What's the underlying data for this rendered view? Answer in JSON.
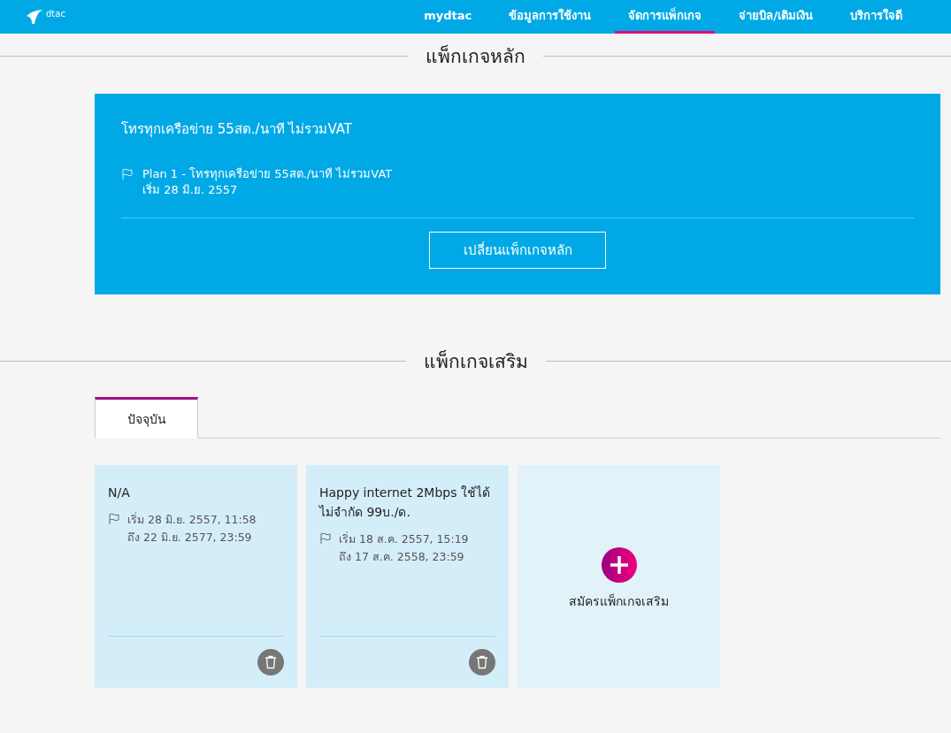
{
  "header": {
    "logo_text": "dtac",
    "nav": [
      {
        "label": "mydtac",
        "selected": false
      },
      {
        "label": "ข้อมูลการใช้งาน",
        "selected": false
      },
      {
        "label": "จัดการแพ็กเกจ",
        "selected": true
      },
      {
        "label": "จ่ายบิล/เติมเงิน",
        "selected": false
      },
      {
        "label": "บริการใจดี",
        "selected": false
      }
    ]
  },
  "main_package": {
    "heading": "แพ็กเกจหลัก",
    "title": "โทรทุกเครือข่าย 55สต./นาที ไม่รวมVAT",
    "plan": "Plan 1 - โทรทุกเครือข่าย 55สต./นาที ไม่รวมVAT",
    "start": "เริ่ม 28 มิ.ย. 2557",
    "button": "เปลี่ยนแพ็กเกจหลัก"
  },
  "addons": {
    "heading": "แพ็กเกจเสริม",
    "tabs": [
      {
        "label": "ปัจจุบัน",
        "selected": true
      }
    ],
    "cards": [
      {
        "title": "N/A",
        "start": "เริ่ม 28 มิ.ย. 2557, 11:58",
        "end": "ถึง 22 มิ.ย. 2577, 23:59"
      },
      {
        "title": "Happy internet 2Mbps ใช้ได้ไม่จำกัด 99บ./ด.",
        "start": "เริ่ม 18 ส.ค. 2557, 15:19",
        "end": "ถึง 17 ส.ค. 2558, 23:59"
      }
    ],
    "add_label": "สมัครแพ็กเกจเสริม"
  }
}
